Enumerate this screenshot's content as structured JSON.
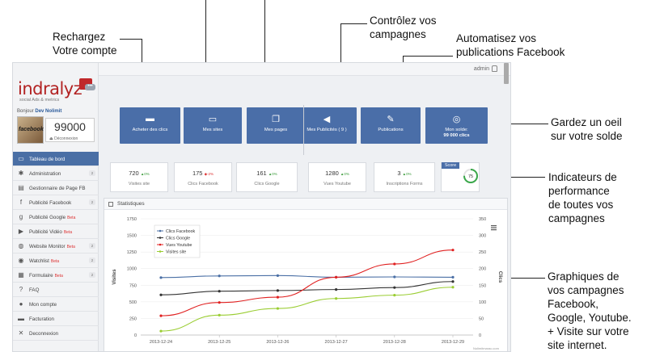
{
  "annotations": {
    "recharge": [
      "Rechargez",
      "Votre compte"
    ],
    "controle": [
      "Contrôlez vos",
      "campagnes"
    ],
    "automatisez": [
      "Automatisez vos",
      "publications Facebook"
    ],
    "solde": [
      "Gardez un oeil",
      "sur votre solde"
    ],
    "indicateurs": [
      "Indicateurs de",
      "performance",
      "de toutes vos",
      "campagnes"
    ],
    "graphiques": [
      "Graphiques de",
      "vos campagnes",
      "Facebook,",
      "Google, Youtube.",
      "+ Visite sur votre",
      "site internet."
    ]
  },
  "topbar": {
    "user": "admin"
  },
  "sidebar": {
    "logo_text": "indralyz",
    "logo_tagline": "social Ads & metrics",
    "greeting_prefix": "Bonjour",
    "user_name": "Dev Nolimit",
    "avatar_text": "facebook",
    "balance": "99000",
    "logout": "Déconnexion",
    "items": [
      {
        "label": "Tableau de bord",
        "icon": "monitor-icon",
        "active": true,
        "beta": "",
        "count": ""
      },
      {
        "label": "Administration",
        "icon": "gears-icon",
        "active": false,
        "beta": "",
        "count": "2"
      },
      {
        "label": "Gestionnaire de Page FB",
        "icon": "file-icon",
        "active": false,
        "beta": "",
        "count": ""
      },
      {
        "label": "Publicité Facebook",
        "icon": "facebook-icon",
        "active": false,
        "beta": "",
        "count": "2"
      },
      {
        "label": "Publicité Google",
        "icon": "google-icon",
        "active": false,
        "beta": "Beta",
        "count": ""
      },
      {
        "label": "Publicité Vidéo",
        "icon": "youtube-icon",
        "active": false,
        "beta": "Beta",
        "count": ""
      },
      {
        "label": "Website Monitor",
        "icon": "globe-icon",
        "active": false,
        "beta": "Beta",
        "count": "2"
      },
      {
        "label": "Watchlist",
        "icon": "eye-icon",
        "active": false,
        "beta": "Beta",
        "count": "2"
      },
      {
        "label": "Formulaire",
        "icon": "form-icon",
        "active": false,
        "beta": "Beta",
        "count": "2"
      },
      {
        "label": "FAQ",
        "icon": "question-icon",
        "active": false,
        "beta": "",
        "count": ""
      },
      {
        "label": "Mon compte",
        "icon": "user-icon",
        "active": false,
        "beta": "",
        "count": ""
      },
      {
        "label": "Facturation",
        "icon": "invoice-icon",
        "active": false,
        "beta": "",
        "count": ""
      },
      {
        "label": "Deconnexion",
        "icon": "close-icon",
        "active": false,
        "beta": "",
        "count": ""
      }
    ]
  },
  "tiles": [
    {
      "label": "Acheter des clics",
      "label2": "",
      "icon": "credit-card-icon"
    },
    {
      "label": "Mes sites",
      "label2": "",
      "icon": "monitor-icon"
    },
    {
      "label": "Mes pages",
      "label2": "",
      "icon": "pages-icon"
    },
    {
      "label": "Mes Publicités ( 9 )",
      "label2": "",
      "icon": "megaphone-icon"
    },
    {
      "label": "Publications",
      "label2": "",
      "icon": "publish-icon"
    },
    {
      "label": "Mon solde:",
      "label2": "99 000 clics",
      "icon": "coins-icon"
    }
  ],
  "kpis": [
    {
      "value": "720",
      "delta": "0%",
      "dir": "up",
      "label": "Visites site"
    },
    {
      "value": "175",
      "delta": "-2%",
      "dir": "dn",
      "label": "Clics Facebook"
    },
    {
      "value": "161",
      "delta": "0%",
      "dir": "up",
      "label": "Clics Google"
    },
    {
      "value": "1280",
      "delta": "0%",
      "dir": "up",
      "label": "Vues Youtube"
    },
    {
      "value": "3",
      "delta": "0%",
      "dir": "up",
      "label": "Inscriptions Forms"
    }
  ],
  "score": {
    "label": "Score",
    "value": "75",
    "fraction": 0.75
  },
  "stats": {
    "title": "Statistiques",
    "credit": "Nolimitmarac.com"
  },
  "chart_data": {
    "type": "line",
    "x": [
      "2013-12-24",
      "2013-12-25",
      "2013-12-26",
      "2013-12-27",
      "2013-12-28",
      "2013-12-29"
    ],
    "ylabel": "Visites",
    "y2label": "Clics",
    "ylim": [
      0,
      1750
    ],
    "y2lim": [
      0,
      350
    ],
    "yticks": [
      0,
      250,
      500,
      750,
      1000,
      1250,
      1500,
      1750
    ],
    "y2ticks": [
      0,
      50,
      100,
      150,
      200,
      250,
      300,
      350
    ],
    "legend_position": "top-left",
    "series": [
      {
        "name": "Clics Facebook",
        "axis": "right",
        "color": "#4a6fa5",
        "values": [
          173,
          178,
          179,
          174,
          175,
          174
        ]
      },
      {
        "name": "Clics Google",
        "axis": "right",
        "color": "#333333",
        "values": [
          121,
          132,
          134,
          137,
          143,
          161
        ]
      },
      {
        "name": "Vues Youtube",
        "axis": "left",
        "color": "#e02020",
        "values": [
          290,
          490,
          570,
          870,
          1070,
          1280
        ]
      },
      {
        "name": "Visites site",
        "axis": "left",
        "color": "#9acd32",
        "values": [
          60,
          300,
          400,
          550,
          600,
          720
        ]
      }
    ]
  }
}
